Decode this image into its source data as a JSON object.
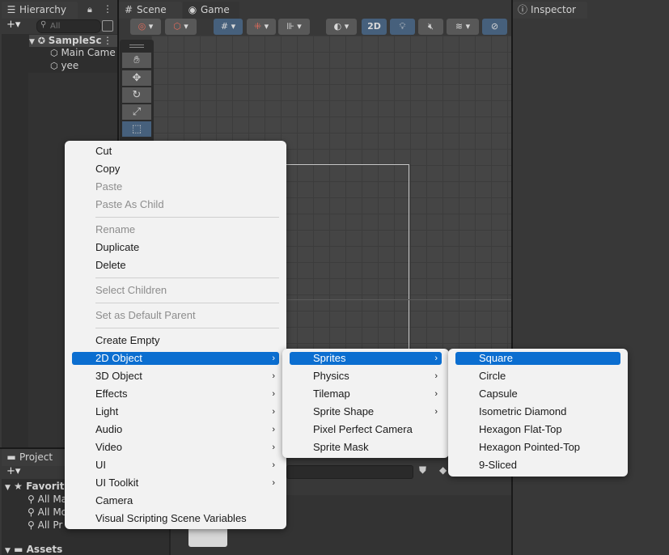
{
  "hierarchy": {
    "tab_label": "Hierarchy",
    "add_label": "+▾",
    "search_placeholder": "All",
    "scene_name": "SampleSc",
    "items": [
      "Main Came",
      "yee"
    ]
  },
  "scene_view": {
    "tabs": [
      "Scene",
      "Game"
    ],
    "mode_2d_label": "2D"
  },
  "inspector": {
    "tab_label": "Inspector"
  },
  "project": {
    "tab_label": "Project",
    "add_label": "+▾",
    "favorites_label": "Favorite",
    "favorite_items": [
      "All Ma",
      "All Mo",
      "All Pr"
    ],
    "assets_label": "Assets"
  },
  "context_menu": {
    "items": [
      {
        "label": "Cut",
        "disabled": false
      },
      {
        "label": "Copy",
        "disabled": false
      },
      {
        "label": "Paste",
        "disabled": true
      },
      {
        "label": "Paste As Child",
        "disabled": true
      },
      {
        "label": "Rename",
        "disabled": true
      },
      {
        "label": "Duplicate",
        "disabled": false
      },
      {
        "label": "Delete",
        "disabled": false
      },
      {
        "label": "Select Children",
        "disabled": true
      },
      {
        "label": "Set as Default Parent",
        "disabled": true
      },
      {
        "label": "Create Empty",
        "disabled": false
      },
      {
        "label": "2D Object",
        "disabled": false,
        "submenu": true,
        "selected": true
      },
      {
        "label": "3D Object",
        "disabled": false,
        "submenu": true
      },
      {
        "label": "Effects",
        "disabled": false,
        "submenu": true
      },
      {
        "label": "Light",
        "disabled": false,
        "submenu": true
      },
      {
        "label": "Audio",
        "disabled": false,
        "submenu": true
      },
      {
        "label": "Video",
        "disabled": false,
        "submenu": true
      },
      {
        "label": "UI",
        "disabled": false,
        "submenu": true
      },
      {
        "label": "UI Toolkit",
        "disabled": false,
        "submenu": true
      },
      {
        "label": "Camera",
        "disabled": false
      },
      {
        "label": "Visual Scripting Scene Variables",
        "disabled": false
      }
    ]
  },
  "submenu_2d": {
    "items": [
      {
        "label": "Sprites",
        "submenu": true,
        "selected": true
      },
      {
        "label": "Physics",
        "submenu": true
      },
      {
        "label": "Tilemap",
        "submenu": true
      },
      {
        "label": "Sprite Shape",
        "submenu": true
      },
      {
        "label": "Pixel Perfect Camera",
        "submenu": false
      },
      {
        "label": "Sprite Mask",
        "submenu": false
      }
    ]
  },
  "submenu_sprites": {
    "items": [
      {
        "label": "Square",
        "selected": true
      },
      {
        "label": "Circle"
      },
      {
        "label": "Capsule"
      },
      {
        "label": "Isometric Diamond"
      },
      {
        "label": "Hexagon Flat-Top"
      },
      {
        "label": "Hexagon Pointed-Top"
      },
      {
        "label": "9-Sliced"
      }
    ]
  },
  "colors": {
    "accent": "#0b6ed0",
    "toolbar_active": "#46607c"
  }
}
